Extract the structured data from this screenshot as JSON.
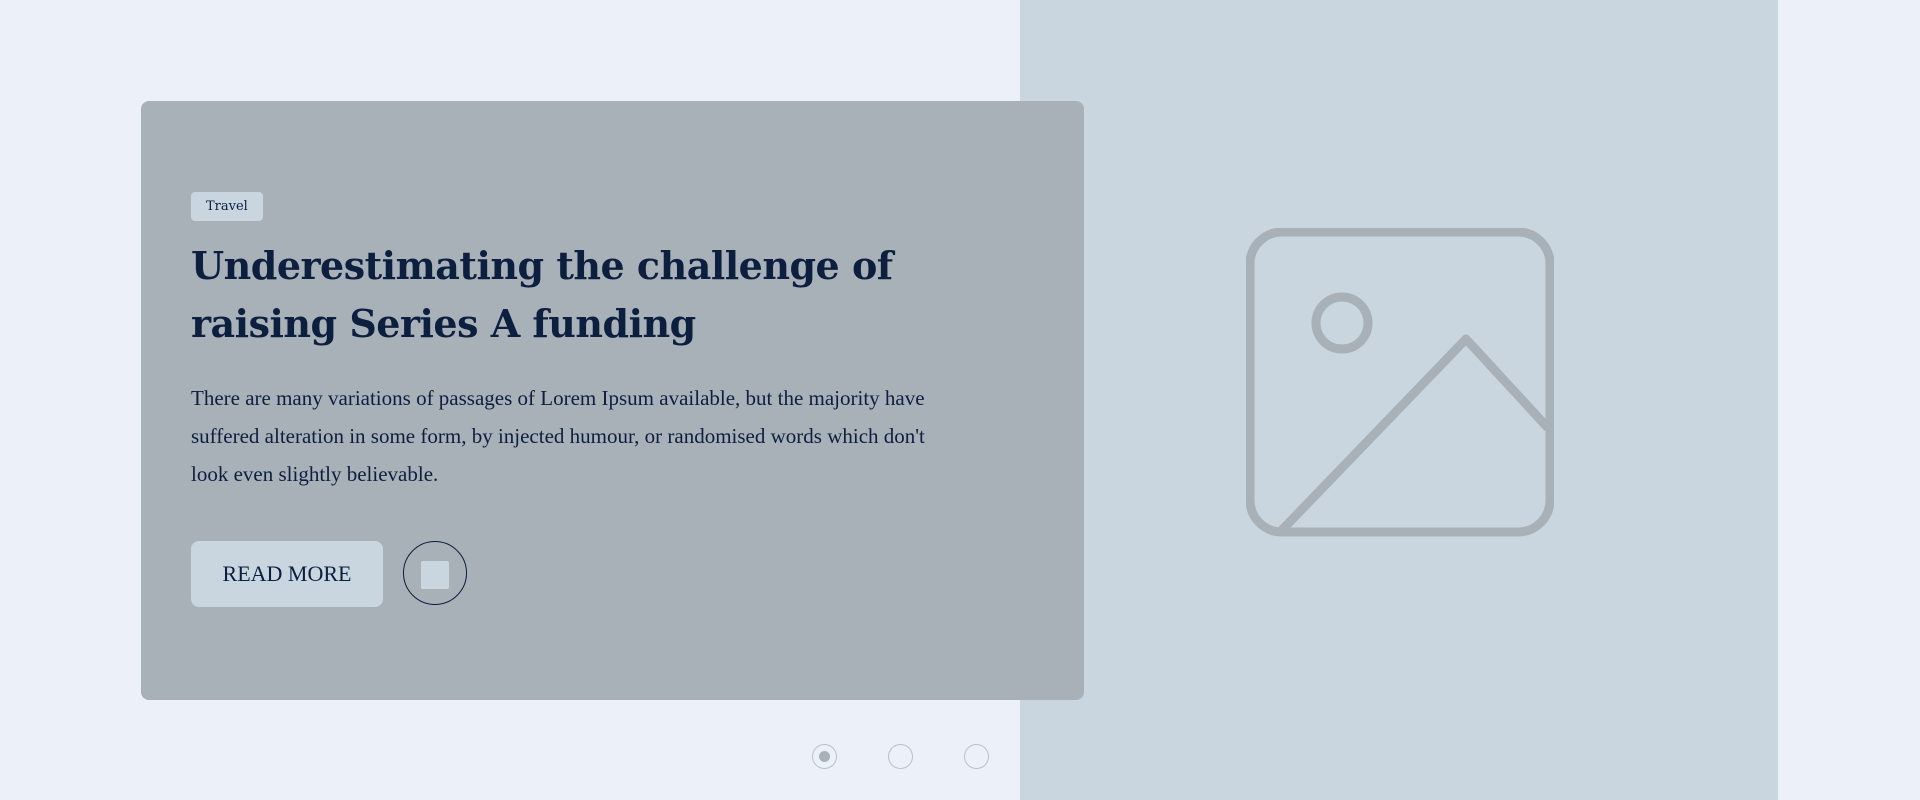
{
  "hero": {
    "category_tag": "Travel",
    "title": "Underestimating the challenge of raising Series A funding",
    "excerpt": "There are many variations of passages of Lorem Ipsum available, but the majority have suffered alteration in some form, by injected humour, or randomised words which don't look even slightly believable.",
    "read_more_label": "READ MORE",
    "media_icon": "stop-icon",
    "image_placeholder_icon": "image-placeholder-icon"
  },
  "carousel": {
    "slide_count": 3,
    "active_index": 0
  },
  "colors": {
    "page_background": "#ecf1f9",
    "image_panel": "#c9d6df",
    "card_background": "#a8b0b8",
    "text_primary": "#0d1f3f",
    "icon_stroke": "#a8b0b8"
  }
}
